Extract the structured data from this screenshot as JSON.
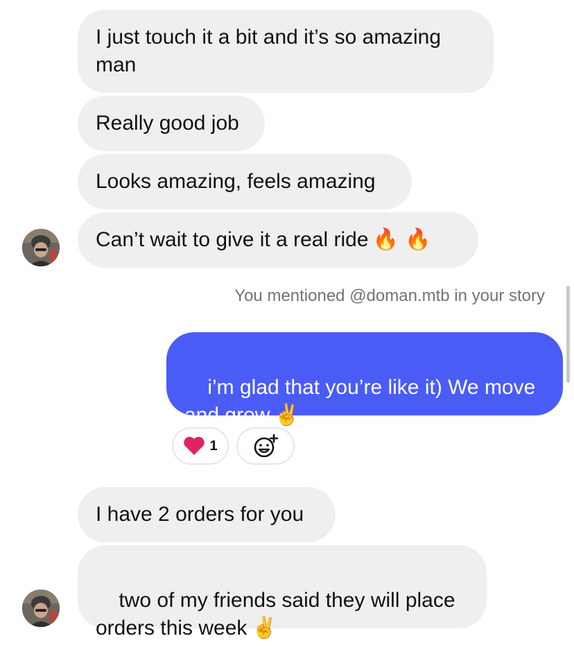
{
  "messages": [
    {
      "id": "m1",
      "text": "I just touch it a bit and it’s so amazing\nman"
    },
    {
      "id": "m2",
      "text": "Really good job"
    },
    {
      "id": "m3",
      "text": "Looks amazing, feels amazing"
    },
    {
      "id": "m4",
      "text": "Can’t wait to give it a real ride",
      "emoji": "🔥 🔥"
    },
    {
      "id": "m5",
      "text": "i’m glad that you’re like it) We move\nand grow",
      "emoji": "✌️"
    },
    {
      "id": "m6",
      "text": "I have 2 orders for you"
    },
    {
      "id": "m7",
      "text": "two of my friends said they will place\norders this week",
      "emoji": "✌️"
    }
  ],
  "system_note": "You mentioned @doman.mtb in your story",
  "reactions": {
    "heart_count": "1",
    "heart_icon": "heart-icon",
    "add_reaction_icon": "add-reaction-icon"
  },
  "colors": {
    "outgoing_bubble": "#4a5cf6",
    "incoming_bubble": "#efefef",
    "heart": "#e0245e",
    "meta_text": "#737373"
  },
  "avatar": {
    "icon": "avatar-photo"
  }
}
